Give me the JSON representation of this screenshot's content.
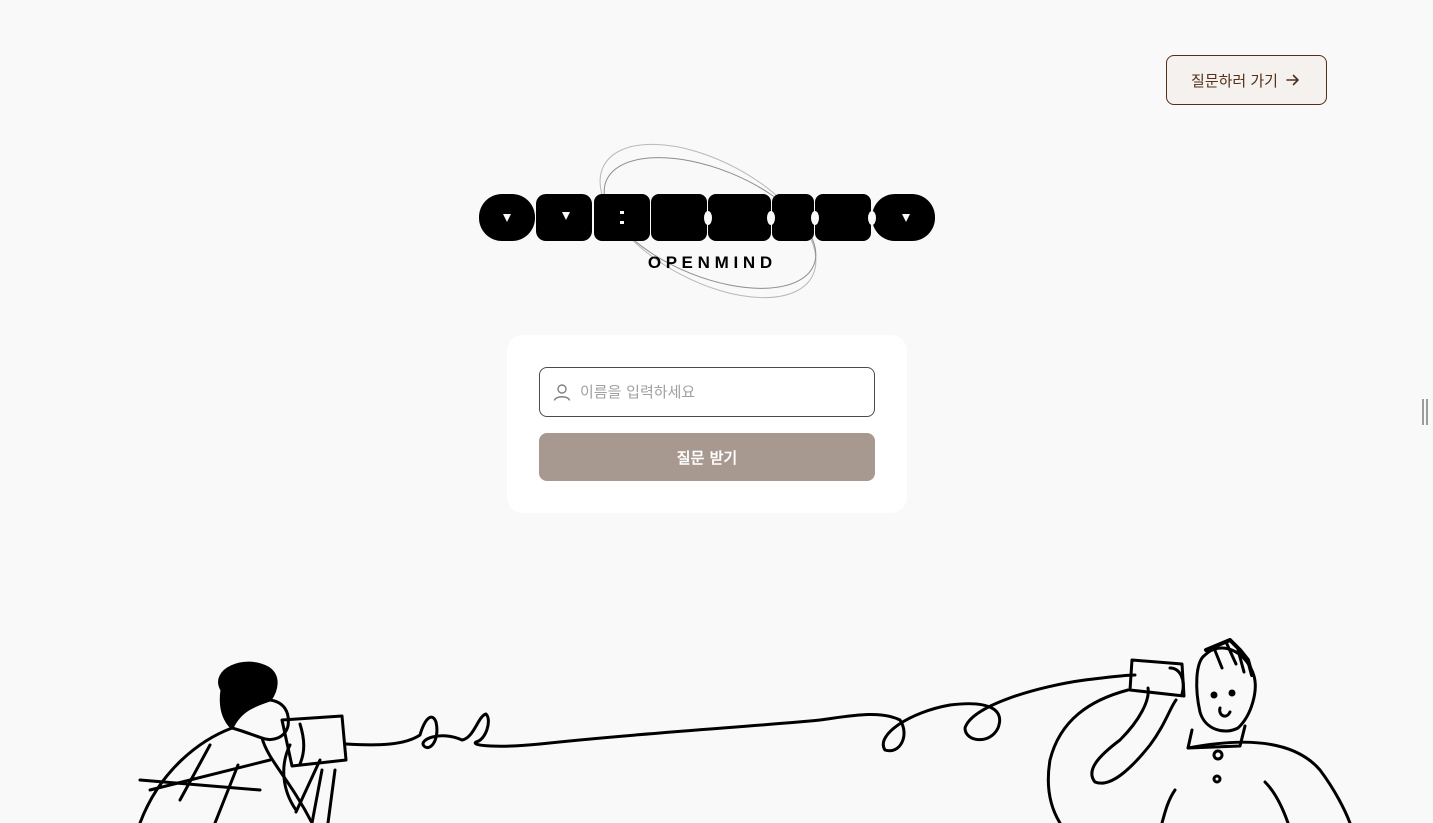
{
  "header": {
    "go_question_label": "질문하러 가기",
    "arrow_icon": "arrow-right-icon"
  },
  "logo": {
    "wordmark": "OPENMIND",
    "subtitle": "O P E N M I N D"
  },
  "form": {
    "name_placeholder": "이름을 입력하세요",
    "name_value": "",
    "person_icon": "person-icon",
    "submit_label": "질문 받기"
  },
  "colors": {
    "background": "#f9f9f9",
    "brown": "#542f1a",
    "button_muted": "#a89990",
    "card": "#ffffff"
  },
  "illustration": {
    "description_icon": "tin-can-phone-people-illustration"
  }
}
